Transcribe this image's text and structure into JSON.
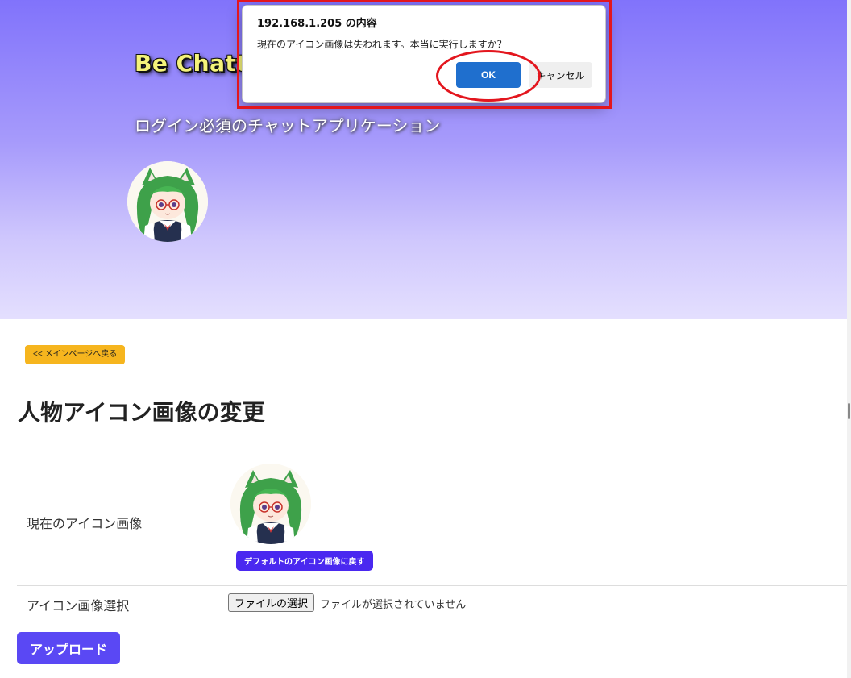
{
  "header": {
    "brand": "Be Chatt",
    "tagline": "ログイン必須のチャットアプリケーション",
    "avatar_icon": "anime-girl-avatar"
  },
  "main": {
    "back_button": "<< メインページへ戻る",
    "title": "人物アイコン画像の変更",
    "current_icon_label": "現在のアイコン画像",
    "default_icon_button": "デフォルトのアイコン画像に戻す",
    "select_label": "アイコン画像選択",
    "file_button": "ファイルの選択",
    "file_status": "ファイルが選択されていません",
    "upload_button": "アップロード"
  },
  "dialog": {
    "title": "192.168.1.205 の内容",
    "message": "現在のアイコン画像は失われます。本当に実行しますか？",
    "ok": "OK",
    "cancel": "キャンセル"
  },
  "colors": {
    "annotation": "#e3161e",
    "ok_button": "#1f6fce",
    "back_button": "#f6b51e",
    "primary": "#5a48f4"
  }
}
